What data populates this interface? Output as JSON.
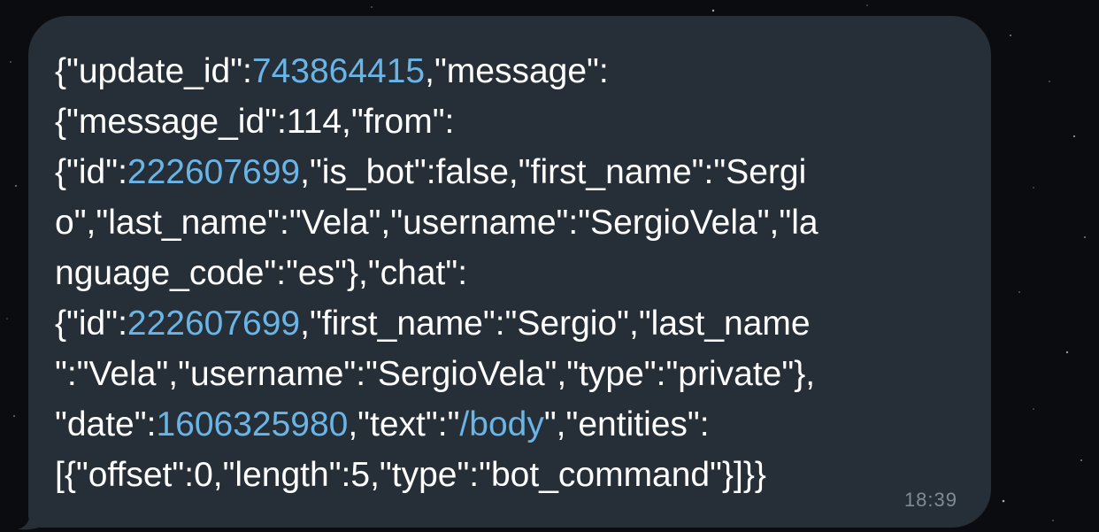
{
  "background_color": "#0a0c0f",
  "bubble_color": "#262f37",
  "link_color": "#6ab4e6",
  "message": {
    "lines": [
      [
        {
          "text": "{\"update_id\":",
          "link": false
        },
        {
          "text": "743864415",
          "link": true
        },
        {
          "text": ",\"message\":",
          "link": false
        }
      ],
      [
        {
          "text": "{\"message_id\":114,\"from\":",
          "link": false
        }
      ],
      [
        {
          "text": "{\"id\":",
          "link": false
        },
        {
          "text": "222607699",
          "link": true
        },
        {
          "text": ",\"is_bot\":false,\"first_name\":\"Sergi",
          "link": false
        }
      ],
      [
        {
          "text": "o\",\"last_name\":\"Vela\",\"username\":\"SergioVela\",\"la",
          "link": false
        }
      ],
      [
        {
          "text": "nguage_code\":\"es\"},\"chat\":",
          "link": false
        }
      ],
      [
        {
          "text": "{\"id\":",
          "link": false
        },
        {
          "text": "222607699",
          "link": true
        },
        {
          "text": ",\"first_name\":\"Sergio\",\"last_name",
          "link": false
        }
      ],
      [
        {
          "text": "\":\"Vela\",\"username\":\"SergioVela\",\"type\":\"private\"},",
          "link": false
        }
      ],
      [
        {
          "text": "\"date\":",
          "link": false
        },
        {
          "text": "1606325980",
          "link": true
        },
        {
          "text": ",\"text\":\"",
          "link": false
        },
        {
          "text": "/body",
          "link": true
        },
        {
          "text": "\",\"entities\":",
          "link": false
        }
      ],
      [
        {
          "text": "[{\"offset\":0,\"length\":5,\"type\":\"bot_command\"}]}}",
          "link": false
        }
      ]
    ],
    "time": "18:39"
  }
}
